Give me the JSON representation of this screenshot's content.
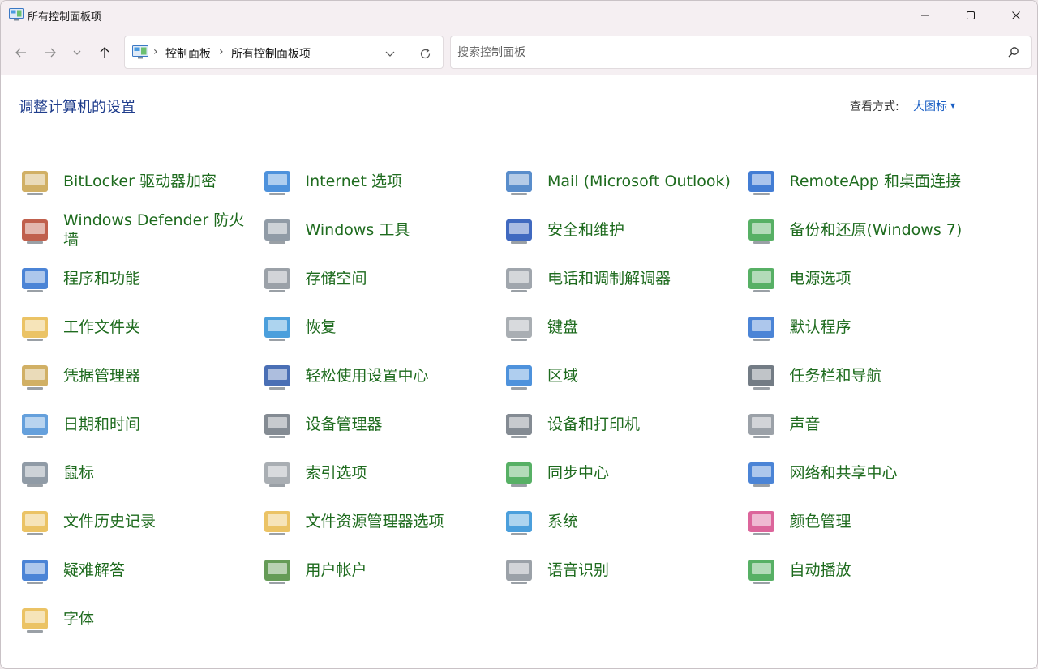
{
  "window": {
    "title": "所有控制面板项"
  },
  "address": {
    "crumbs": [
      "控制面板",
      "所有控制面板项"
    ],
    "sep": "›"
  },
  "search": {
    "placeholder": "搜索控制面板"
  },
  "header": {
    "title": "调整计算机的设置",
    "view_by_label": "查看方式:",
    "view_by_value": "大图标"
  },
  "items": [
    {
      "label": "BitLocker 驱动器加密",
      "icon": "bitlocker-icon",
      "color": "#c9a24a"
    },
    {
      "label": "Internet 选项",
      "icon": "internet-options-icon",
      "color": "#2f7fd6"
    },
    {
      "label": "Mail (Microsoft Outlook)",
      "icon": "mail-icon",
      "color": "#3c79c2"
    },
    {
      "label": "RemoteApp 和桌面连接",
      "icon": "remoteapp-icon",
      "color": "#2266cc"
    },
    {
      "label": "Windows Defender 防火墙",
      "icon": "firewall-icon",
      "color": "#b5442e"
    },
    {
      "label": "Windows 工具",
      "icon": "windows-tools-icon",
      "color": "#7d8a96"
    },
    {
      "label": "安全和维护",
      "icon": "security-flag-icon",
      "color": "#1f4fb5"
    },
    {
      "label": "备份和还原(Windows 7)",
      "icon": "backup-icon",
      "color": "#3aa24a"
    },
    {
      "label": "程序和功能",
      "icon": "programs-icon",
      "color": "#2b6fcf"
    },
    {
      "label": "存储空间",
      "icon": "storage-icon",
      "color": "#8a9199"
    },
    {
      "label": "电话和调制解调器",
      "icon": "phone-modem-icon",
      "color": "#8f979f"
    },
    {
      "label": "电源选项",
      "icon": "power-options-icon",
      "color": "#3aa24a"
    },
    {
      "label": "工作文件夹",
      "icon": "work-folders-icon",
      "color": "#e8b84a"
    },
    {
      "label": "恢复",
      "icon": "recovery-icon",
      "color": "#2b8ed6"
    },
    {
      "label": "键盘",
      "icon": "keyboard-icon",
      "color": "#9aa0a6"
    },
    {
      "label": "默认程序",
      "icon": "default-programs-icon",
      "color": "#2b6fcf"
    },
    {
      "label": "凭据管理器",
      "icon": "credential-manager-icon",
      "color": "#c9a24a"
    },
    {
      "label": "轻松使用设置中心",
      "icon": "ease-of-access-icon",
      "color": "#2a56a8"
    },
    {
      "label": "区域",
      "icon": "region-icon",
      "color": "#2f7fd6"
    },
    {
      "label": "任务栏和导航",
      "icon": "taskbar-icon",
      "color": "#5a6570"
    },
    {
      "label": "日期和时间",
      "icon": "date-time-icon",
      "color": "#4a8fd6"
    },
    {
      "label": "设备管理器",
      "icon": "device-manager-icon",
      "color": "#6f7780"
    },
    {
      "label": "设备和打印机",
      "icon": "devices-printers-icon",
      "color": "#6f7780"
    },
    {
      "label": "声音",
      "icon": "sound-icon",
      "color": "#8a9199"
    },
    {
      "label": "鼠标",
      "icon": "mouse-icon",
      "color": "#7d8a96"
    },
    {
      "label": "索引选项",
      "icon": "indexing-icon",
      "color": "#9aa0a6"
    },
    {
      "label": "同步中心",
      "icon": "sync-center-icon",
      "color": "#3aa24a"
    },
    {
      "label": "网络和共享中心",
      "icon": "network-icon",
      "color": "#2b6fcf"
    },
    {
      "label": "文件历史记录",
      "icon": "file-history-icon",
      "color": "#e8b84a"
    },
    {
      "label": "文件资源管理器选项",
      "icon": "explorer-options-icon",
      "color": "#e8b84a"
    },
    {
      "label": "系统",
      "icon": "system-icon",
      "color": "#2b8ed6"
    },
    {
      "label": "颜色管理",
      "icon": "color-management-icon",
      "color": "#d64a8a"
    },
    {
      "label": "疑难解答",
      "icon": "troubleshooting-icon",
      "color": "#2b6fcf"
    },
    {
      "label": "用户帐户",
      "icon": "user-accounts-icon",
      "color": "#4a8a3a"
    },
    {
      "label": "语音识别",
      "icon": "speech-recognition-icon",
      "color": "#8a9199"
    },
    {
      "label": "自动播放",
      "icon": "autoplay-icon",
      "color": "#3aa24a"
    },
    {
      "label": "字体",
      "icon": "fonts-icon",
      "color": "#e8b84a"
    }
  ]
}
